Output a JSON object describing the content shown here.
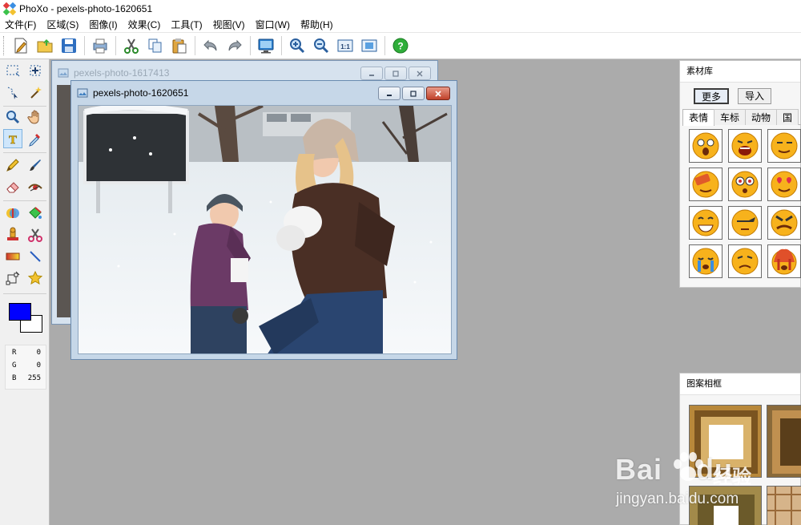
{
  "app": {
    "title": "PhoXo - pexels-photo-1620651"
  },
  "menu": [
    {
      "label": "文件(F)",
      "name": "menu-file"
    },
    {
      "label": "区域(S)",
      "name": "menu-region"
    },
    {
      "label": "图像(I)",
      "name": "menu-image"
    },
    {
      "label": "效果(C)",
      "name": "menu-effects"
    },
    {
      "label": "工具(T)",
      "name": "menu-tools"
    },
    {
      "label": "视图(V)",
      "name": "menu-view"
    },
    {
      "label": "窗口(W)",
      "name": "menu-window"
    },
    {
      "label": "帮助(H)",
      "name": "menu-help"
    }
  ],
  "toolbar": [
    {
      "icon": "new-file-icon"
    },
    {
      "icon": "open-folder-icon"
    },
    {
      "icon": "save-icon"
    },
    {
      "icon": "print-icon"
    },
    {
      "icon": "cut-icon"
    },
    {
      "icon": "copy-icon"
    },
    {
      "icon": "paste-icon"
    },
    {
      "icon": "undo-icon"
    },
    {
      "icon": "redo-icon"
    },
    {
      "icon": "screen-capture-icon"
    },
    {
      "icon": "zoom-in-icon"
    },
    {
      "icon": "zoom-out-icon"
    },
    {
      "icon": "actual-size-icon"
    },
    {
      "icon": "fit-window-icon"
    },
    {
      "icon": "help-icon"
    }
  ],
  "tools": [
    "rect-select-icon",
    "move-icon",
    "lasso-select-icon",
    "magic-wand-icon",
    "zoom-icon",
    "hand-pan-icon",
    "text-icon",
    "eyedropper-icon",
    "pencil-icon",
    "brush-icon",
    "eraser-icon",
    "smudge-icon",
    "color-replace-icon",
    "fill-bucket-icon",
    "clone-stamp-icon",
    "scissors-icon",
    "gradient-icon",
    "line-icon",
    "transform-icon",
    "star-shape-icon"
  ],
  "colors": {
    "foreground": "#0000ff",
    "background": "#ffffff",
    "r_label": "R",
    "r": "0",
    "g_label": "G",
    "g": "0",
    "b_label": "B",
    "b": "255"
  },
  "documents": {
    "back_title": "pexels-photo-1617413",
    "front_title": "pexels-photo-1620651"
  },
  "material_panel": {
    "title": "素材库",
    "more_button": "更多",
    "import_button": "导入",
    "tabs": [
      "表情",
      "车标",
      "动物",
      "国"
    ],
    "emojis": [
      "surprised-emoji-icon",
      "crying-loud-emoji-icon",
      "smirk-emoji-icon",
      "blushing-emoji-icon",
      "dizzy-emoji-icon",
      "love-emoji-icon",
      "grin-emoji-icon",
      "pouting-emoji-icon",
      "angry-emoji-icon",
      "tears-emoji-icon",
      "frown-emoji-icon",
      "burning-emoji-icon"
    ]
  },
  "frame_panel": {
    "title": "图案相框"
  },
  "watermark": {
    "brand": "Bai",
    "brand2": "du",
    "cn": "经验",
    "url": "jingyan.baidu.com"
  }
}
